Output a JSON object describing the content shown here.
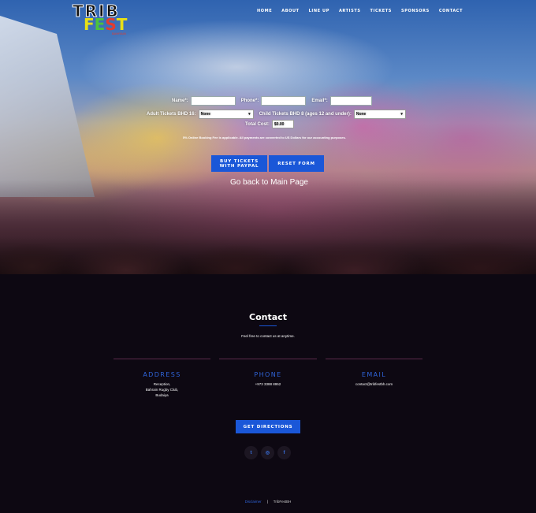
{
  "logo": {
    "line1": "TRIB",
    "fest_letters": [
      "F",
      "E",
      "S",
      "T"
    ],
    "sub": "BAHRAIN"
  },
  "nav": [
    "HOME",
    "ABOUT",
    "LINE UP",
    "ARTISTS",
    "TICKETS",
    "SPONSORS",
    "CONTACT"
  ],
  "form": {
    "name_label": "Name*:",
    "phone_label": "Phone*:",
    "email_label": "Email*:",
    "adult_label": "Adult Tickets BHD 16:",
    "adult_value": "None",
    "child_label": "Child Tickets BHD 8 (ages 12 and under):",
    "child_value": "None",
    "cost_label": "Total Cost:",
    "cost_value": "$0.00",
    "note": "5% Online Booking Fee is applicable. All payments are converted to US Dollars for our accounting purposes."
  },
  "buttons": {
    "paypal_line1": "BUY TICKETS",
    "paypal_line2": "WITH PAYPAL",
    "reset": "RESET FORM",
    "back": "Go back to Main Page"
  },
  "contact": {
    "title": "Contact",
    "subtitle": "Feel free to contact us at anytime.",
    "address_head": "ADDRESS",
    "address_lines": [
      "Reception,",
      "Bahrain Rugby Club,",
      "Budaiya"
    ],
    "phone_head": "PHONE",
    "phone_value": "+973 3388 8952",
    "email_head": "EMAIL",
    "email_value": "contact@tribfestbh.com",
    "directions": "GET DIRECTIONS"
  },
  "social": {
    "twitter": "t",
    "instagram": "◎",
    "facebook": "f"
  },
  "footer": {
    "disclaimer": "Disclaimer",
    "separator": "|",
    "brand": "TribFestBH"
  },
  "colors": {
    "accent": "#1a57d8",
    "background": "#0d0812"
  }
}
